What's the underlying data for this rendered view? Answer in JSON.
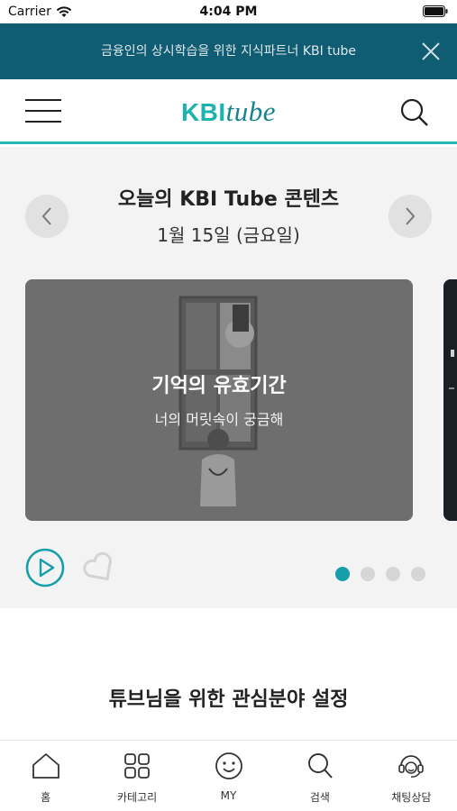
{
  "status_bar": {
    "carrier": "Carrier",
    "time": "4:04 PM"
  },
  "banner": {
    "text": "금융인의 상시학습을 위한 지식파트너 KBI tube",
    "close_icon": "close-icon"
  },
  "header": {
    "logo_kbi": "KBI",
    "logo_tube": "tube",
    "menu_icon": "menu-icon",
    "search_icon": "search-icon",
    "accent_color": "#23b9b9"
  },
  "today": {
    "title": "오늘의 KBI Tube 콘텐츠",
    "date": "1월 15일 (금요일)",
    "card": {
      "title": "기억의 유효기간",
      "subtitle": "너의 머릿속이 궁금해"
    },
    "carousel": {
      "total": 4,
      "active": 1
    },
    "actions": {
      "play_icon": "play-icon",
      "like_icon": "heart-icon"
    }
  },
  "interests": {
    "title": "튜브님을 위한 관심분야 설정"
  },
  "tabbar": {
    "items": [
      {
        "label": "홈",
        "icon": "home-icon"
      },
      {
        "label": "카테고리",
        "icon": "grid-icon"
      },
      {
        "label": "MY",
        "icon": "smile-icon"
      },
      {
        "label": "검색",
        "icon": "search-icon"
      },
      {
        "label": "채팅상담",
        "icon": "headset-icon"
      }
    ]
  },
  "colors": {
    "banner_bg": "#105c72",
    "brand": "#1bb3ad",
    "dot_active": "#169eab"
  }
}
